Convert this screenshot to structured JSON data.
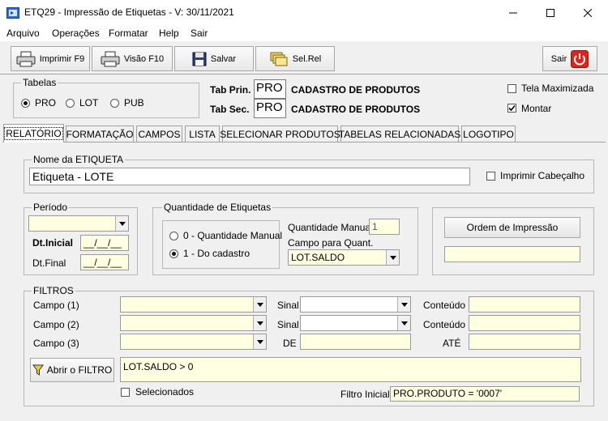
{
  "window": {
    "title": "ETQ29 - Impressão de Etiquetas - V: 30/11/2021"
  },
  "menu": [
    "Arquivo",
    "Operações",
    "Formatar",
    "Help",
    "Sair"
  ],
  "toolbar": {
    "print": "Imprimir F9",
    "preview": "Visão F10",
    "save": "Salvar",
    "selrel": "Sel.Rel",
    "exit": "Sair"
  },
  "tabelas": {
    "label": "Tabelas",
    "options": [
      "PRO",
      "LOT",
      "PUB"
    ],
    "selected": "PRO"
  },
  "tab_prin": {
    "label": "Tab Prin.",
    "code": "PRO",
    "desc": "CADASTRO DE PRODUTOS"
  },
  "tab_sec": {
    "label": "Tab Sec.",
    "code": "PRO",
    "desc": "CADASTRO DE PRODUTOS"
  },
  "options": {
    "maximized": "Tela Maximizada",
    "maximized_checked": false,
    "montar": "Montar",
    "montar_checked": true
  },
  "tabs": [
    "RELATÓRIO",
    "FORMATAÇÃO",
    "CAMPOS",
    "LISTA",
    "SELECIONAR PRODUTOS",
    "TABELAS RELACIONADAS",
    "LOGOTIPO"
  ],
  "active_tab": "RELATÓRIO",
  "etiqueta": {
    "label": "Nome da ETIQUETA",
    "value": "Etiqueta - LOTE",
    "print_header": "Imprimir Cabeçalho",
    "print_header_checked": false
  },
  "periodo": {
    "label": "Período",
    "select_value": "",
    "dt_inicial_label": "Dt.Inicial",
    "dt_inicial_value": "__/__/__",
    "dt_final_label": "Dt.Final",
    "dt_final_value": "__/__/__"
  },
  "quantidade": {
    "label": "Quantidade de Etiquetas",
    "options": [
      "0 - Quantidade Manual",
      "1 - Do cadastro"
    ],
    "selected": "1 - Do cadastro",
    "manual_label": "Quantidade Manual",
    "manual_value": "1",
    "campo_label": "Campo para Quant.",
    "campo_value": "LOT.SALDO"
  },
  "ordem": {
    "button": "Ordem de Impressão",
    "value": ""
  },
  "filtros": {
    "label": "FILTROS",
    "rows": [
      {
        "campo_label": "Campo (1)",
        "campo_value": "",
        "mid_label": "Sinal",
        "mid_value": "",
        "right_label": "Conteúdo",
        "right_value": ""
      },
      {
        "campo_label": "Campo (2)",
        "campo_value": "",
        "mid_label": "Sinal",
        "mid_value": "",
        "right_label": "Conteúdo",
        "right_value": ""
      },
      {
        "campo_label": "Campo (3)",
        "campo_value": "",
        "mid_label": "DE",
        "mid_value": "",
        "right_label": "ATÉ",
        "right_value": ""
      }
    ],
    "open_button": "Abrir o FILTRO",
    "filter_text": "LOT.SALDO > 0",
    "selected_label": "Selecionados",
    "selected_checked": false,
    "initial_label": "Filtro Inicial",
    "initial_value": "PRO.PRODUTO = '0007'"
  },
  "colors": {
    "field": "#ffffe1",
    "window": "#f0f0f0",
    "exit_icon": "#e0241b"
  }
}
